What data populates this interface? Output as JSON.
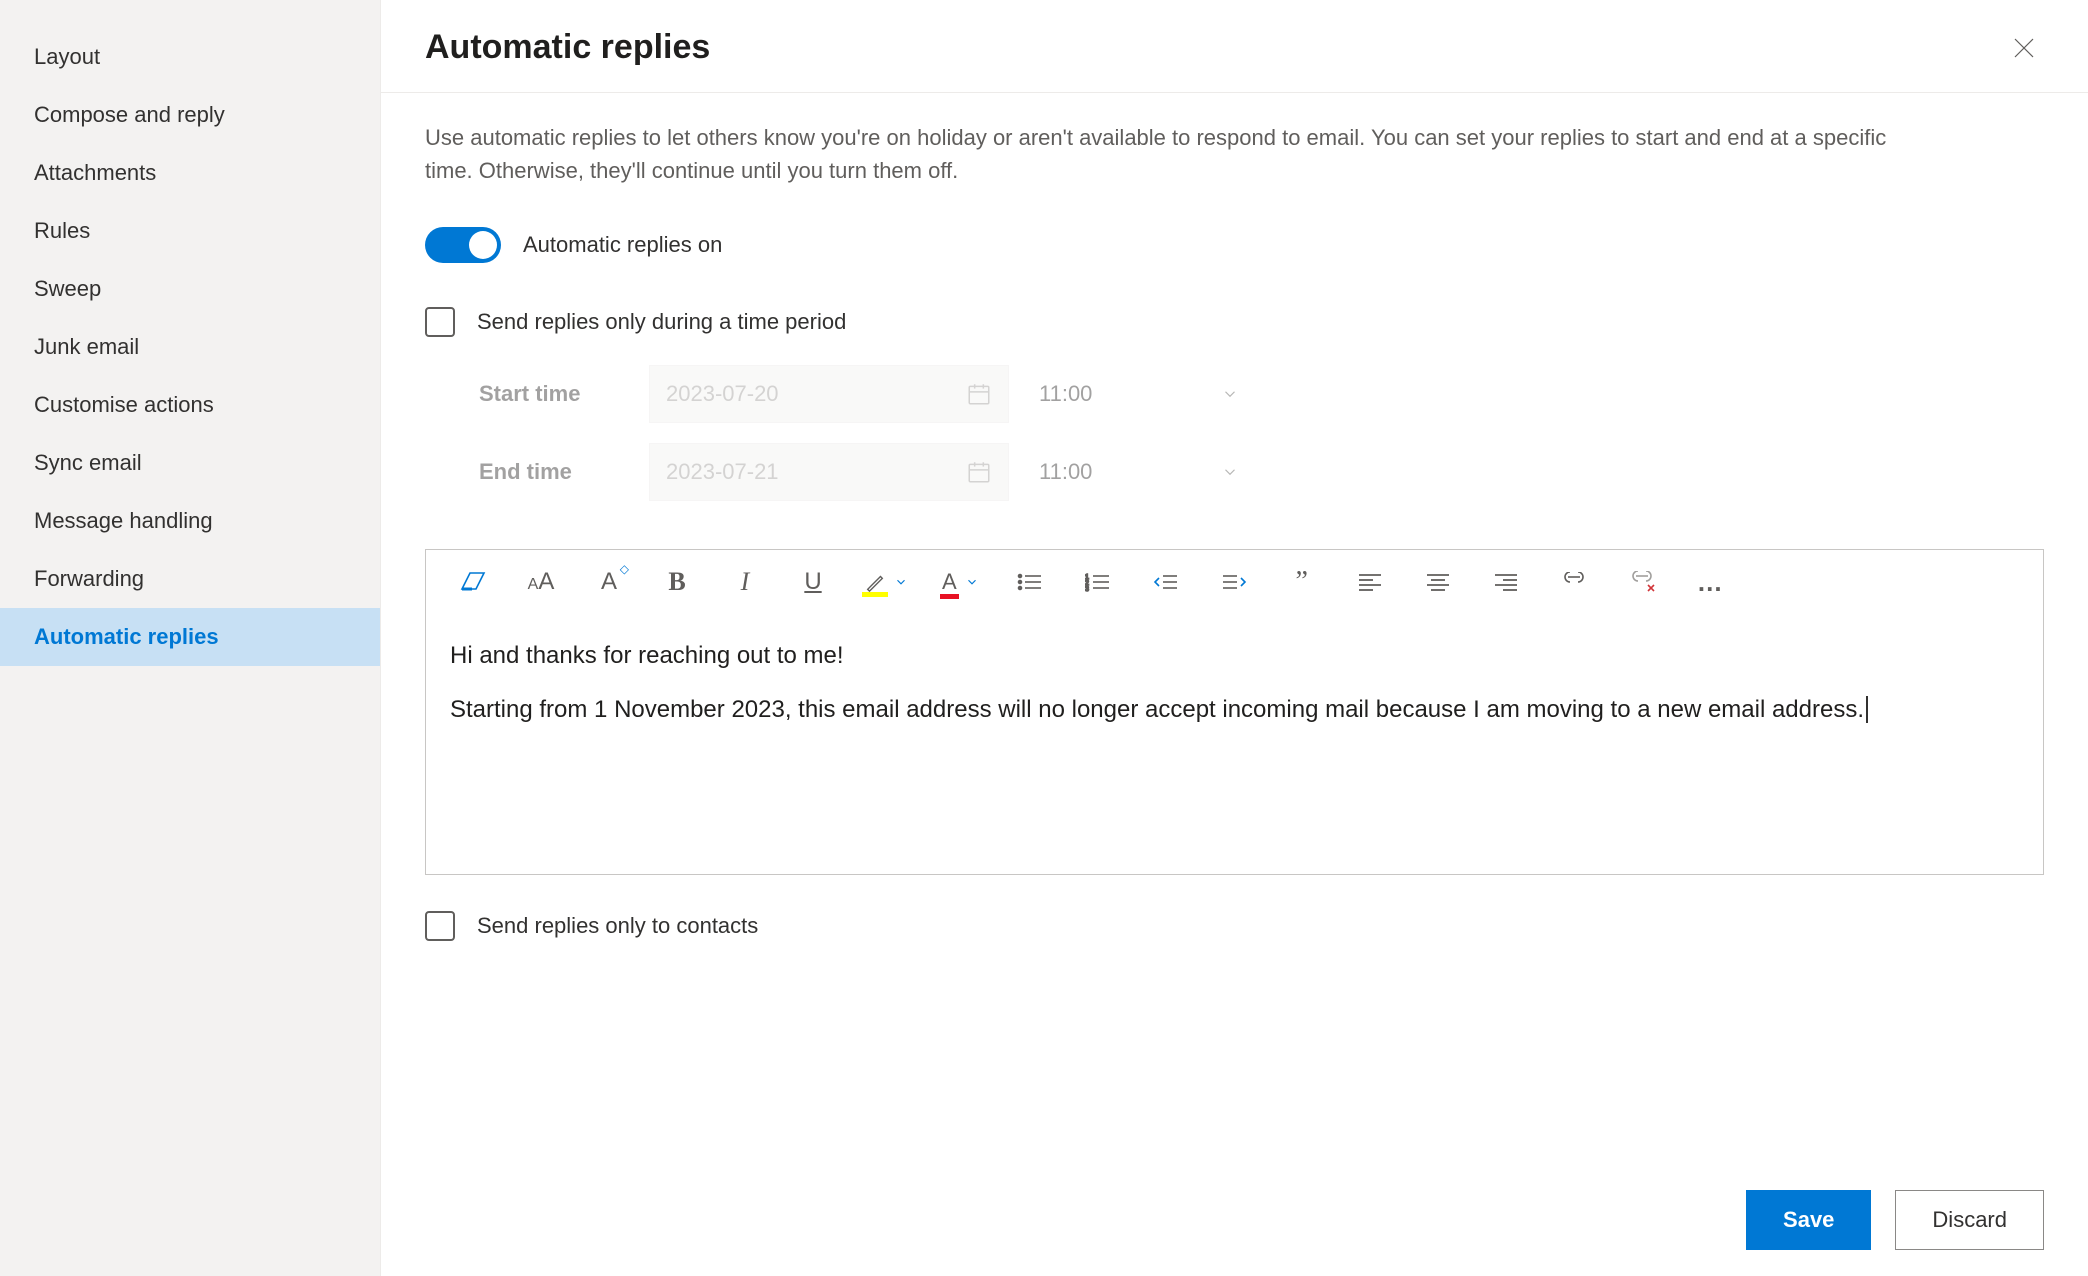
{
  "sidebar": {
    "items": [
      {
        "label": "Layout"
      },
      {
        "label": "Compose and reply"
      },
      {
        "label": "Attachments"
      },
      {
        "label": "Rules"
      },
      {
        "label": "Sweep"
      },
      {
        "label": "Junk email"
      },
      {
        "label": "Customise actions"
      },
      {
        "label": "Sync email"
      },
      {
        "label": "Message handling"
      },
      {
        "label": "Forwarding"
      },
      {
        "label": "Automatic replies"
      }
    ],
    "active_index": 10
  },
  "header": {
    "title": "Automatic replies"
  },
  "description": "Use automatic replies to let others know you're on holiday or aren't available to respond to email. You can set your replies to start and end at a specific time. Otherwise, they'll continue until you turn them off.",
  "toggle": {
    "label": "Automatic replies on",
    "on": true
  },
  "time_period": {
    "checkbox_label": "Send replies only during a time period",
    "checked": false,
    "start_label": "Start time",
    "start_date": "2023-07-20",
    "start_time": "11:00",
    "end_label": "End time",
    "end_date": "2023-07-21",
    "end_time": "11:00"
  },
  "editor": {
    "para1": "Hi and thanks for reaching out to me!",
    "para2": "Starting from 1 November 2023, this email address will no longer accept incoming mail because I am moving to a new email address. "
  },
  "contacts_only": {
    "label": "Send replies only to contacts",
    "checked": false
  },
  "buttons": {
    "save": "Save",
    "discard": "Discard"
  },
  "colors": {
    "accent": "#0078d4"
  }
}
